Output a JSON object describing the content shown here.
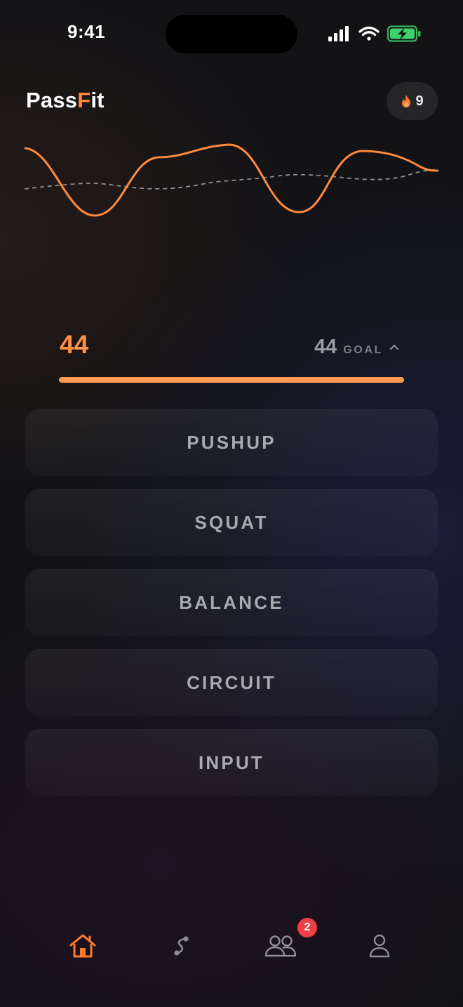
{
  "status_bar": {
    "time": "9:41",
    "icons": [
      "signal-icon",
      "wifi-icon",
      "battery-charging-icon"
    ]
  },
  "header": {
    "title_main": "Pass",
    "title_accent": "F",
    "title_end": "it",
    "streak_icon": "flame-icon",
    "streak_count": "9"
  },
  "progress": {
    "value": "44",
    "goal_value": "44",
    "goal_label": "GOAL",
    "goal_toggle_icon": "chevron-up-icon",
    "fraction": 1.0
  },
  "workouts": [
    "PUSHUP",
    "SQUAT",
    "BALANCE",
    "CIRCUIT",
    "INPUT"
  ],
  "tab_bar": {
    "tabs": [
      {
        "name": "home",
        "icon": "home-icon",
        "active": true
      },
      {
        "name": "route",
        "icon": "route-icon",
        "active": false
      },
      {
        "name": "friends",
        "icon": "friends-icon",
        "active": false
      },
      {
        "name": "profile",
        "icon": "profile-icon",
        "active": false
      }
    ],
    "friends_badge": "2"
  },
  "colors": {
    "accent": "#ff8a3d",
    "background": "#131316",
    "badge": "#ef3f46",
    "button_text": "#a9a9b1"
  }
}
